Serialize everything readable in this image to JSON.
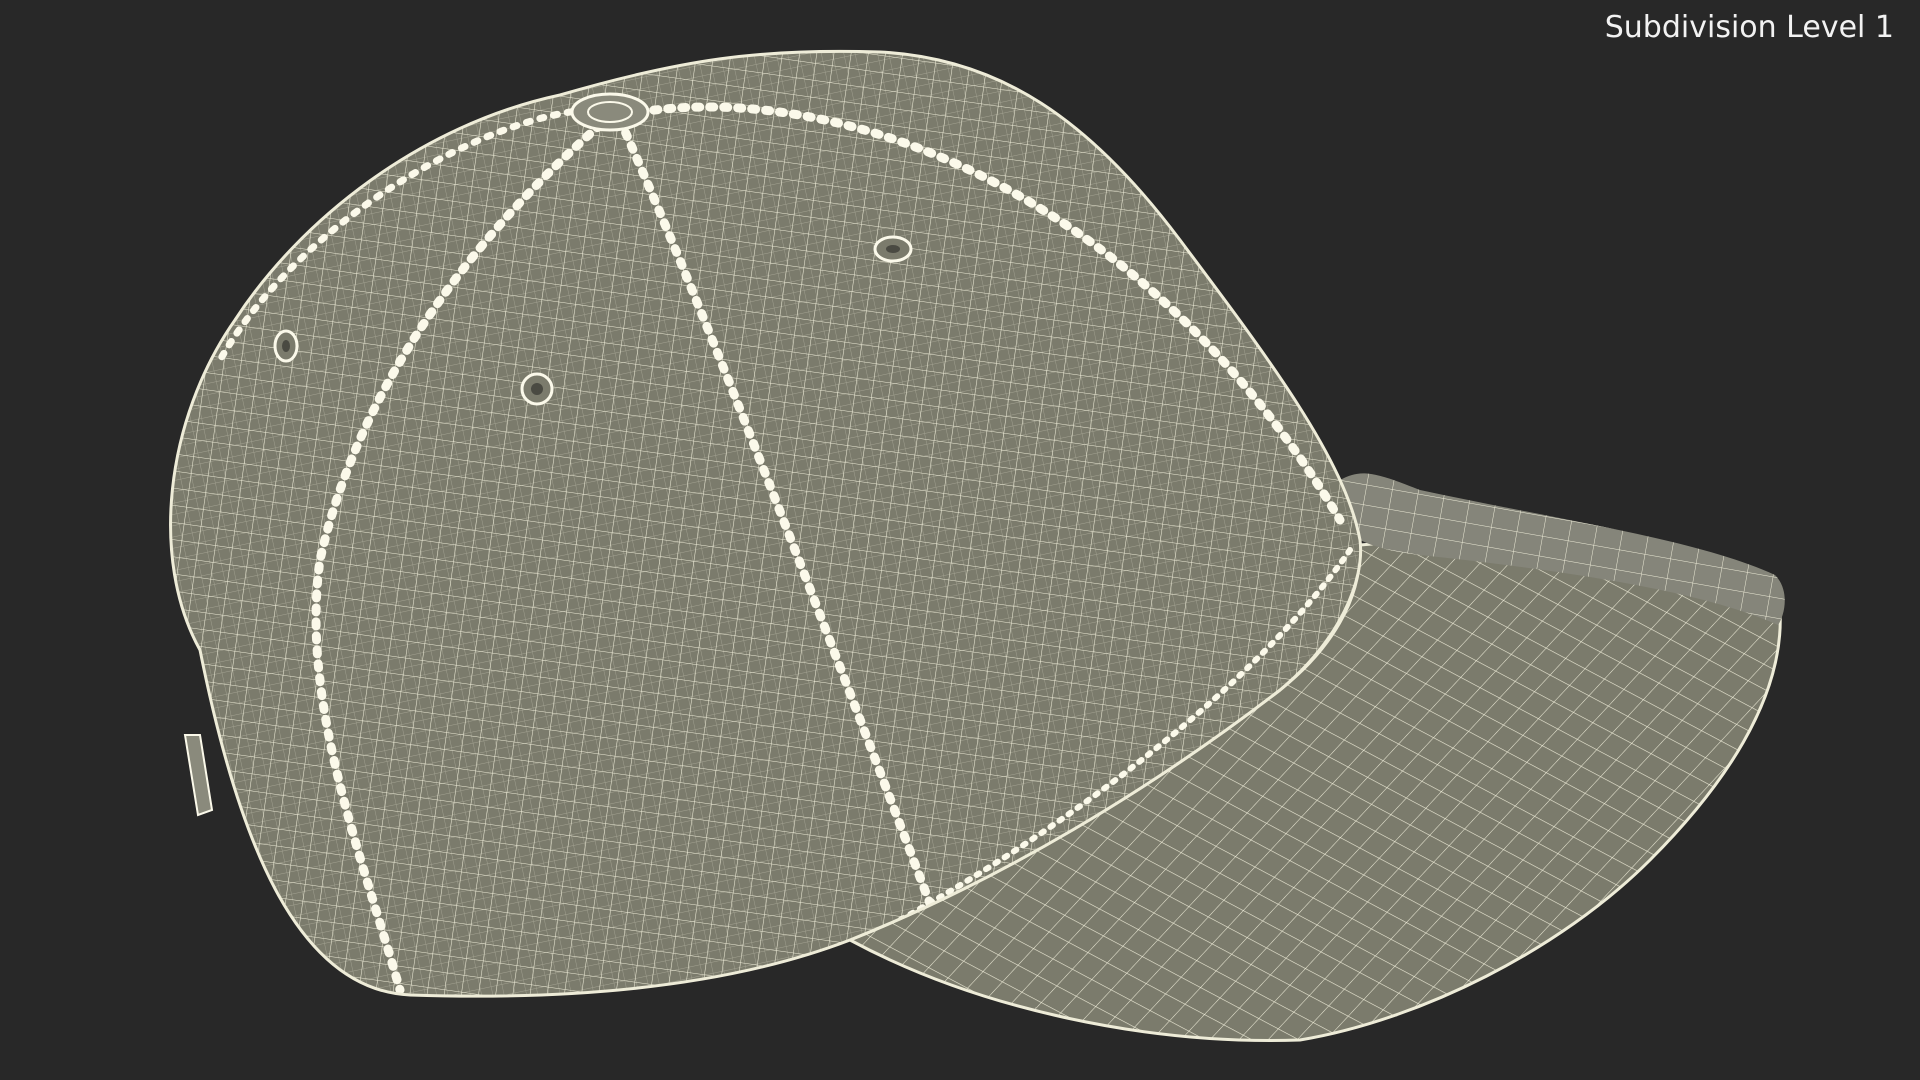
{
  "viewport": {
    "overlay_label": "Subdivision Level 1",
    "background_color": "#282828",
    "mesh_fill_color": "#7b7b6c",
    "wire_color": "#eeecd8",
    "seam_color": "#fbf9ea"
  },
  "scene": {
    "subject_icon": "baseball-cap-wireframe"
  }
}
